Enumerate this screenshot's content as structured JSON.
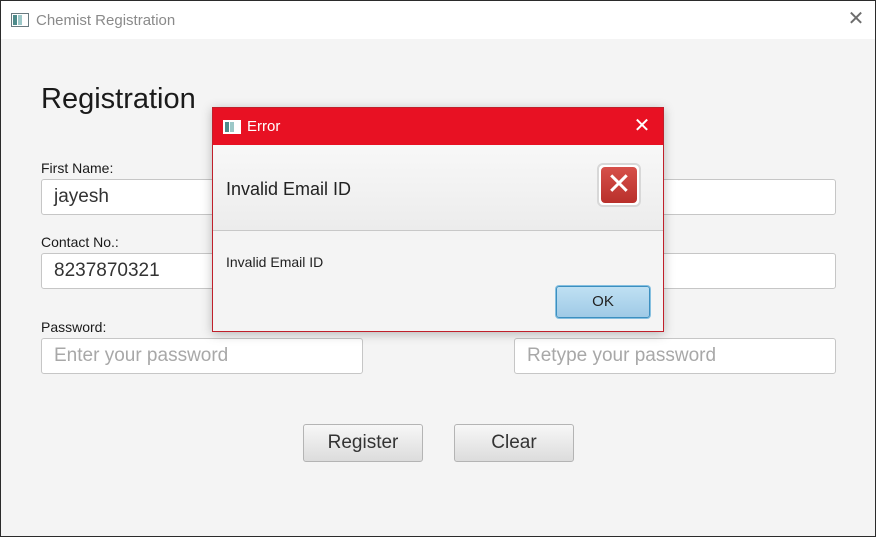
{
  "window": {
    "title": "Chemist Registration",
    "icon": "app-icon",
    "close_glyph": "✕"
  },
  "form": {
    "heading": "Registration",
    "first_name_label": "First Name:",
    "first_name_value": "jayesh",
    "contact_label": "Contact No.:",
    "contact_value": "8237870321",
    "password_label": "Password:",
    "password_placeholder": "Enter your password",
    "retype_placeholder": "Retype your password",
    "register_label": "Register",
    "clear_label": "Clear"
  },
  "dialog": {
    "title": "Error",
    "close_glyph": "✕",
    "header_text": "Invalid Email ID",
    "content_text": "Invalid Email ID",
    "ok_label": "OK",
    "icon": "error-icon",
    "icon_glyph": "✕",
    "accent_color": "#e81123"
  }
}
